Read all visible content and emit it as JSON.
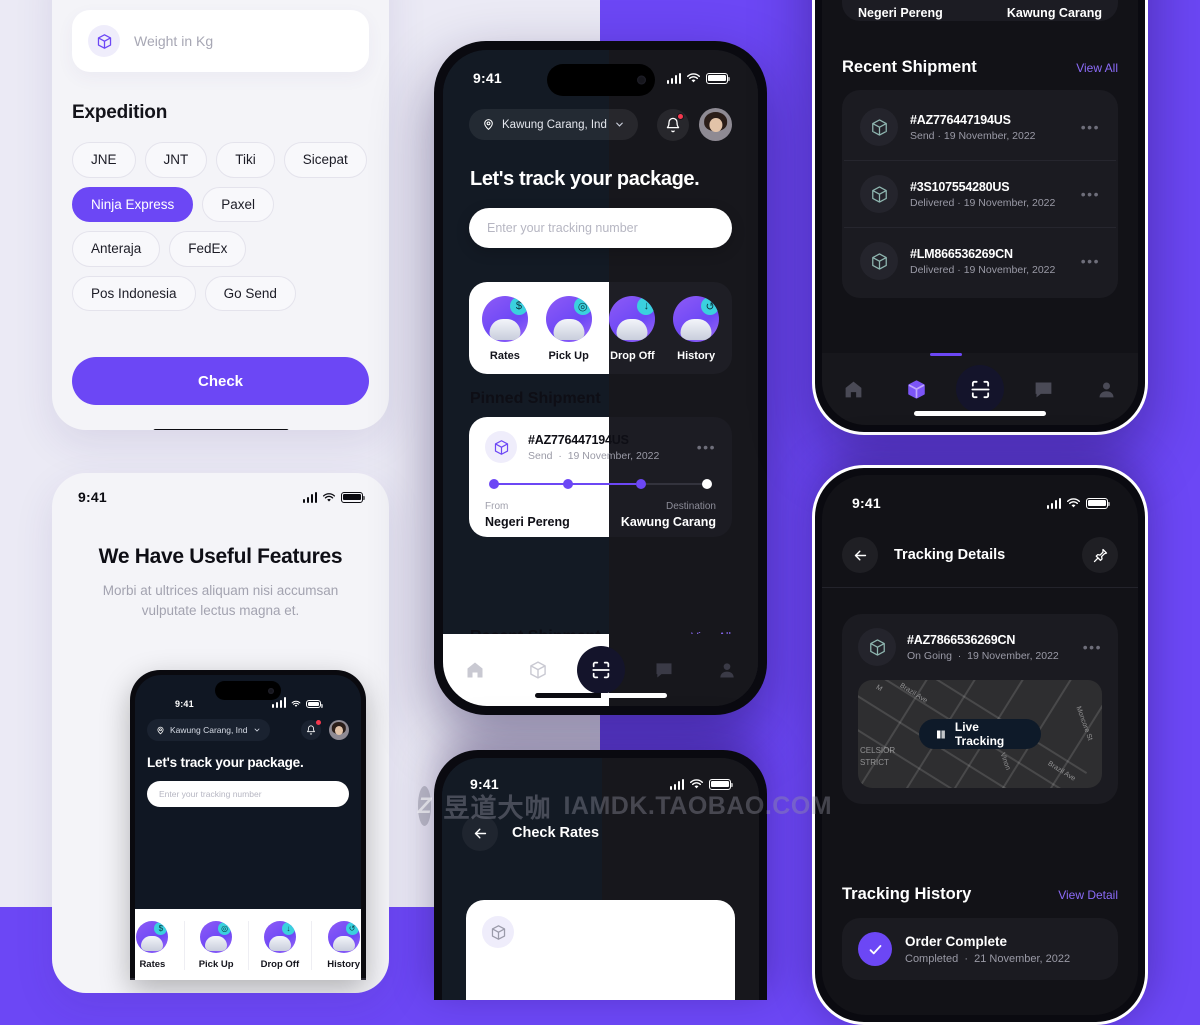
{
  "theme": {
    "accent": "#6C47F5",
    "bg_left": "#EBEAF5",
    "bg_right": "#6C47F5",
    "dark_card": "#1B1B21"
  },
  "panel_expedition": {
    "weight_placeholder": "Weight in Kg",
    "section_title": "Expedition",
    "chips": [
      {
        "label": "JNE",
        "selected": false
      },
      {
        "label": "JNT",
        "selected": false
      },
      {
        "label": "Tiki",
        "selected": false
      },
      {
        "label": "Sicepat",
        "selected": false
      },
      {
        "label": "Ninja Express",
        "selected": true
      },
      {
        "label": "Paxel",
        "selected": false
      },
      {
        "label": "Anteraja",
        "selected": false
      },
      {
        "label": "FedEx",
        "selected": false
      },
      {
        "label": "Pos Indonesia",
        "selected": false
      },
      {
        "label": "Go Send",
        "selected": false
      }
    ],
    "check_label": "Check"
  },
  "panel_features": {
    "status_time": "9:41",
    "title": "We Have Useful Features",
    "subtitle": "Morbi at ultrices aliquam nisi accumsan vulputate lectus magna et.",
    "mini": {
      "status_time": "9:41",
      "location": "Kawung Carang, Ind",
      "headline": "Let's track your package.",
      "input_placeholder": "Enter your tracking number",
      "quick_actions": [
        {
          "label": "Rates",
          "icon": "dollar-badge-icon"
        },
        {
          "label": "Pick Up",
          "icon": "pickup-badge-icon"
        },
        {
          "label": "Drop Off",
          "icon": "dropoff-badge-icon"
        },
        {
          "label": "History",
          "icon": "history-badge-icon"
        }
      ]
    }
  },
  "panel_home": {
    "status_time": "9:41",
    "location": "Kawung Carang, Ind",
    "headline": "Let's track your package.",
    "input_placeholder": "Enter your tracking number",
    "quick_actions": [
      {
        "label": "Rates",
        "icon": "dollar-badge-icon"
      },
      {
        "label": "Pick Up",
        "icon": "pickup-badge-icon"
      },
      {
        "label": "Drop Off",
        "icon": "dropoff-badge-icon"
      },
      {
        "label": "History",
        "icon": "history-badge-icon"
      }
    ],
    "pinned_title": "Pinned Shipment",
    "pinned": {
      "id": "#AZ776447194US",
      "status": "Send",
      "date": "19 November, 2022",
      "from_label": "From",
      "from_value": "Negeri Pereng",
      "dest_label": "Destination",
      "dest_value": "Kawung Carang",
      "progress_nodes": 4,
      "progress_done": 3
    },
    "recent_title": "Recent Shipment",
    "view_all": "View All",
    "tabs": [
      "home-icon",
      "package-icon",
      "scan-icon",
      "chat-icon",
      "profile-icon"
    ]
  },
  "panel_recent": {
    "pin_from_value": "Negeri Pereng",
    "pin_dest_value": "Kawung Carang",
    "section_title": "Recent Shipment",
    "view_all": "View All",
    "items": [
      {
        "id": "#AZ776447194US",
        "status": "Send",
        "date": "19 November, 2022"
      },
      {
        "id": "#3S107554280US",
        "status": "Delivered",
        "date": "19 November, 2022"
      },
      {
        "id": "#LM866536269CN",
        "status": "Delivered",
        "date": "19 November, 2022"
      }
    ],
    "tabs": [
      "home-icon",
      "package-icon",
      "scan-icon",
      "chat-icon",
      "profile-icon"
    ],
    "active_tab": "package-icon"
  },
  "panel_tracking": {
    "status_time": "9:41",
    "nav_title": "Tracking Details",
    "back_icon": "arrow-left-icon",
    "pin_icon": "pin-icon",
    "shipment": {
      "id": "#AZ7866536269CN",
      "status": "On Going",
      "date": "19 November, 2022"
    },
    "map": {
      "live_label": "Live Tracking",
      "labels": [
        "Brazil Ave",
        "Moncore St",
        "Vinon",
        "Brazil Ave",
        "CELSIOR",
        "STRICT",
        "M"
      ]
    },
    "history_title": "Tracking History",
    "view_detail": "View Detail",
    "history": [
      {
        "title": "Order Complete",
        "status": "Completed",
        "date": "21 November, 2022"
      }
    ]
  },
  "panel_rates": {
    "status_time": "9:41",
    "nav_title": "Check Rates",
    "back_icon": "arrow-left-icon"
  },
  "watermark": {
    "badge": "Z",
    "text_cn": "昱道大咖",
    "text_en": "IAMDK.TAOBAO.COM"
  }
}
